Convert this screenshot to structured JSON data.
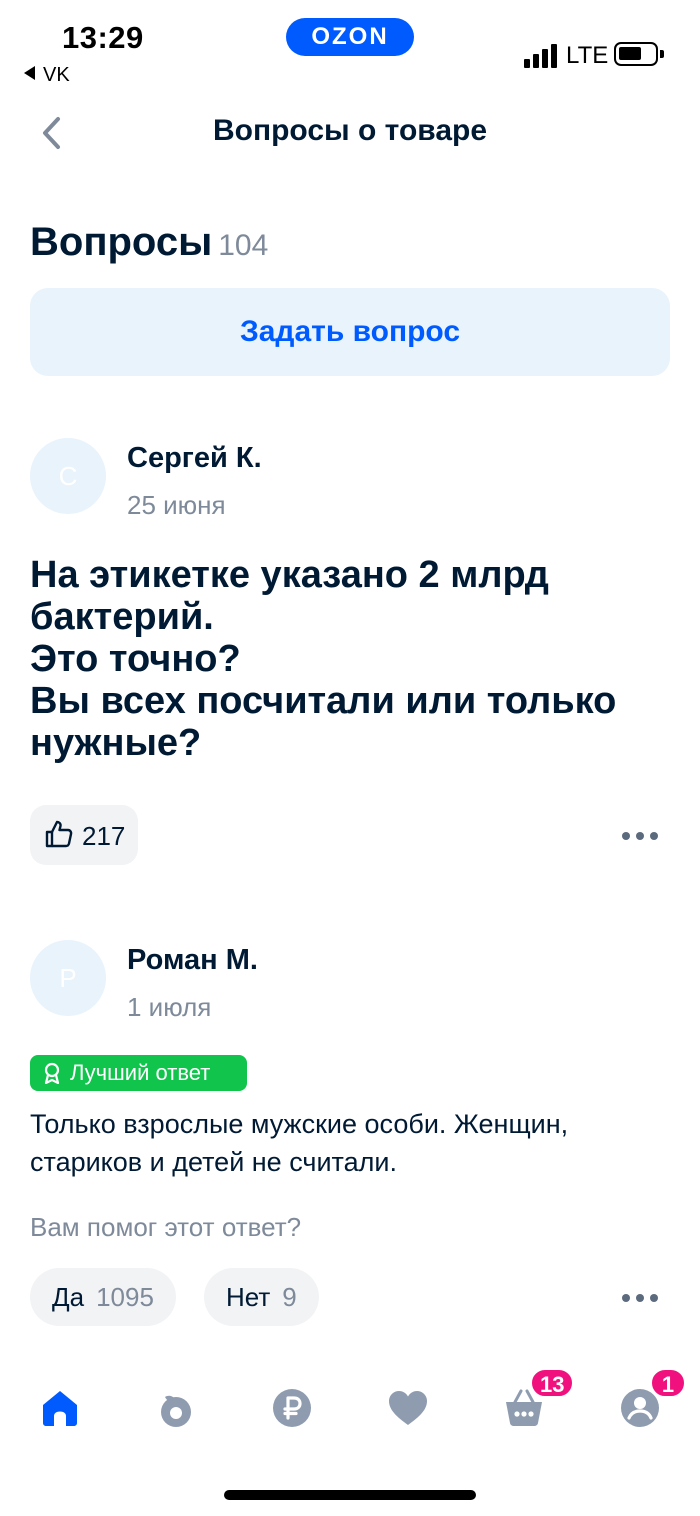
{
  "status_bar": {
    "time": "13:29",
    "back_app": "VK",
    "brand": "OZON",
    "network": "LTE"
  },
  "header": {
    "title": "Вопросы о товаре",
    "back_icon": "chevron-left-icon"
  },
  "questions_section": {
    "heading": "Вопросы",
    "count": "104",
    "ask_button": "Задать вопрос"
  },
  "question": {
    "avatar_letter": "С",
    "author": "Сергей К.",
    "date": "25 июня",
    "text_lines": [
      "На этикетке указано 2 млрд",
      "бактерий.",
      "Это точно?",
      "Вы всех посчитали или только",
      "нужные?"
    ],
    "likes": "217"
  },
  "answer": {
    "avatar_letter": "Р",
    "author": "Роман М.",
    "date": "1 июля",
    "badge": "Лучший ответ",
    "text_lines": [
      "Только взрослые мужские особи. Женщин,",
      "стариков и детей не считали."
    ],
    "helpful_prompt": "Вам помог этот ответ?",
    "yes_label": "Да",
    "yes_count": "1095",
    "no_label": "Нет",
    "no_count": "9"
  },
  "tabbar": {
    "items": [
      {
        "icon": "home-icon",
        "active": true
      },
      {
        "icon": "fresh-icon",
        "active": false
      },
      {
        "icon": "ruble-icon",
        "active": false
      },
      {
        "icon": "heart-icon",
        "active": false
      },
      {
        "icon": "cart-icon",
        "active": false,
        "badge": "13"
      },
      {
        "icon": "profile-icon",
        "active": false,
        "badge": "1"
      }
    ]
  },
  "colors": {
    "accent": "#005bff",
    "badge_green": "#10c44c",
    "badge_pink": "#f1117e",
    "muted": "#7e8a9a",
    "icon_gray": "#8f9cb0"
  }
}
